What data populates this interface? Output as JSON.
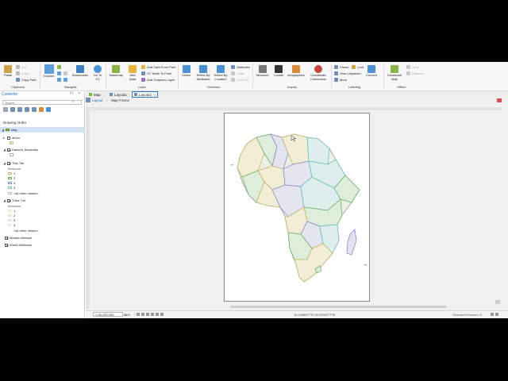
{
  "colors": {
    "accent": "#2b78c5",
    "selection": "#cfe3f5"
  },
  "ribbon": {
    "clipboard": {
      "paste": "Paste",
      "cut": "Cut",
      "copy": "Copy",
      "copy_path": "Copy Path",
      "group": "Clipboard"
    },
    "navigate": {
      "explore": "Explore",
      "bookmarks": "Bookmarks",
      "goto": "Go To XY",
      "group": "Navigate"
    },
    "layer": {
      "basemap": "Basemap",
      "add_data": "Add Data",
      "add_from_path": "Add Data From Path",
      "xy_table": "XY Table To Point",
      "add_graphics": "Add Graphics Layer",
      "group": "Layer"
    },
    "selection": {
      "select": "Select",
      "by_attributes": "Select By Attributes",
      "by_location": "Select By Location",
      "attributes": "Attributes",
      "clear": "Clear",
      "zoom_to": "Zoom To",
      "group": "Selection"
    },
    "inquiry": {
      "measure": "Measure",
      "locate": "Locate",
      "infographics": "Infographics",
      "coord_conv": "Coordinate Conversion",
      "group": "Inquiry"
    },
    "labeling": {
      "pause": "Pause",
      "lock": "Lock",
      "view_unplaced": "View Unplaced",
      "more": "More",
      "group": "Labeling"
    },
    "offline": {
      "convert": "Convert",
      "download": "Download Map",
      "sync": "Sync",
      "remove": "Remove",
      "group": "Offline"
    }
  },
  "tabs": [
    {
      "label": "Map"
    },
    {
      "label": "Layout1"
    },
    {
      "label": "Layout3"
    }
  ],
  "breadcrumb": {
    "layout": "Layout",
    "map_frame": "Map Frame"
  },
  "contents": {
    "title": "Contents",
    "search_placeholder": "Search",
    "drawing_order": "Drawing Order",
    "layers": [
      {
        "label": "Map",
        "type": "map"
      },
      {
        "label": "africa",
        "type": "layer"
      },
      {
        "label": "Dashed_Boundary",
        "type": "layer"
      },
      {
        "label": "Thin Tint",
        "type": "layer"
      },
      {
        "label": "Thick Tint",
        "type": "layer"
      },
      {
        "label": "Modern Antique",
        "type": "layer"
      },
      {
        "label": "World Hillshade",
        "type": "layer"
      }
    ],
    "thin_tint": {
      "field": "thesecon",
      "classes": [
        "1",
        "2",
        "3",
        "4"
      ],
      "other": "<all other values>"
    },
    "thick_tint": {
      "field": "thesecon",
      "classes": [
        "1",
        "2",
        "3",
        "4"
      ],
      "other": "<all other values>"
    }
  },
  "status": {
    "scale": "1:35,000,000",
    "zoom": "86%",
    "coords": "11.0265017°E 26.3701077°N",
    "selected": "Selected Features: 0"
  }
}
